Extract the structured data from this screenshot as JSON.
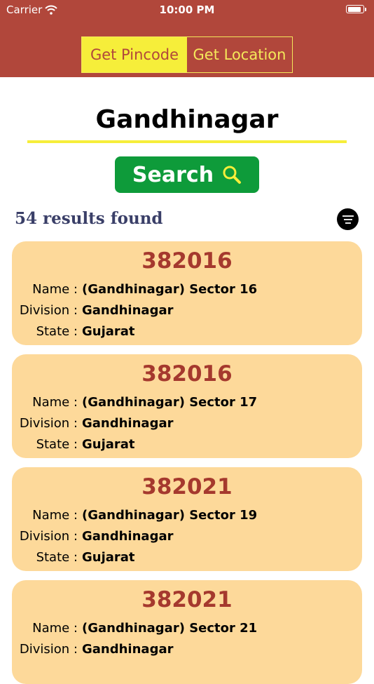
{
  "status": {
    "carrier": "Carrier",
    "time": "10:00 PM"
  },
  "tabs": [
    {
      "label": "Get Pincode",
      "active": true
    },
    {
      "label": "Get Location",
      "active": false
    }
  ],
  "search": {
    "query": "Gandhinagar",
    "button_label": "Search"
  },
  "results": {
    "count_text": "54 results found",
    "labels": {
      "name": "Name :",
      "division": "Division :",
      "state": "State :"
    },
    "items": [
      {
        "pincode": "382016",
        "name": "(Gandhinagar) Sector 16",
        "division": "Gandhinagar",
        "state": "Gujarat"
      },
      {
        "pincode": "382016",
        "name": "(Gandhinagar) Sector 17",
        "division": "Gandhinagar",
        "state": "Gujarat"
      },
      {
        "pincode": "382021",
        "name": "(Gandhinagar) Sector 19",
        "division": "Gandhinagar",
        "state": "Gujarat"
      },
      {
        "pincode": "382021",
        "name": "(Gandhinagar) Sector 21",
        "division": "Gandhinagar",
        "state": ""
      }
    ]
  },
  "colors": {
    "header": "#b1473b",
    "accent_yellow": "#f6ee3a",
    "search_green": "#0e9b3a",
    "card_bg": "#fdd99a",
    "pincode_red": "#a5392e"
  },
  "icons": {
    "wifi": "wifi-icon",
    "battery": "battery-icon",
    "search": "magnifier-icon",
    "sort": "sort-lines-icon"
  }
}
